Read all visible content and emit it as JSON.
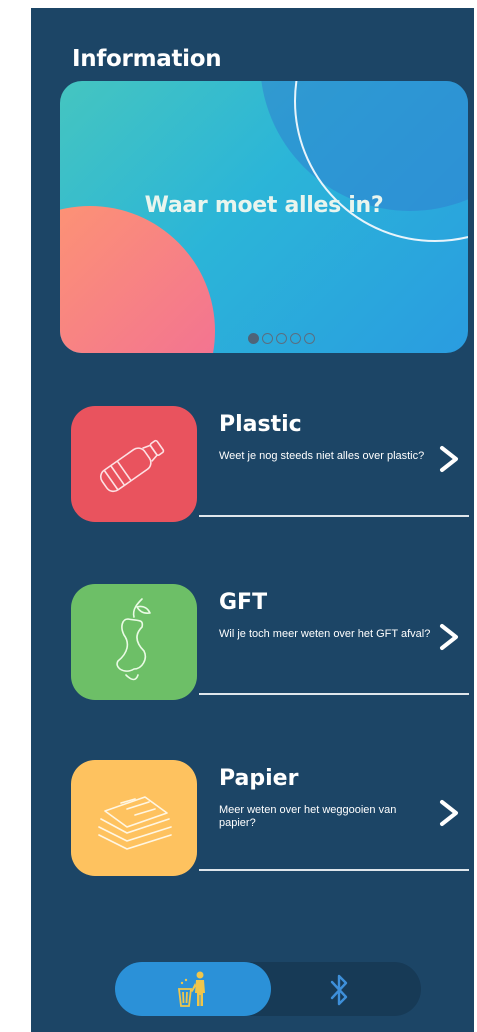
{
  "header": {
    "title": "Information"
  },
  "banner": {
    "text": "Waar moet alles in?",
    "slides": 5,
    "active_slide": 1
  },
  "categories": [
    {
      "title": "Plastic",
      "description": "Weet je nog steeds niet alles over plastic?",
      "color": "#e9535e",
      "icon": "bottle-icon"
    },
    {
      "title": "GFT",
      "description": "Wil je toch meer weten over het GFT afval?",
      "color": "#6dbf67",
      "icon": "apple-core-icon"
    },
    {
      "title": "Papier",
      "description": "Meer weten over het weggooien van papier?",
      "color": "#fec25f",
      "icon": "paper-stack-icon"
    }
  ],
  "bottom_nav": {
    "items": [
      "trash-person-icon",
      "bluetooth-icon"
    ],
    "active": "trash-person-icon"
  },
  "colors": {
    "background": "#1c4566",
    "accent": "#2b91d8",
    "text": "#ffffff"
  }
}
